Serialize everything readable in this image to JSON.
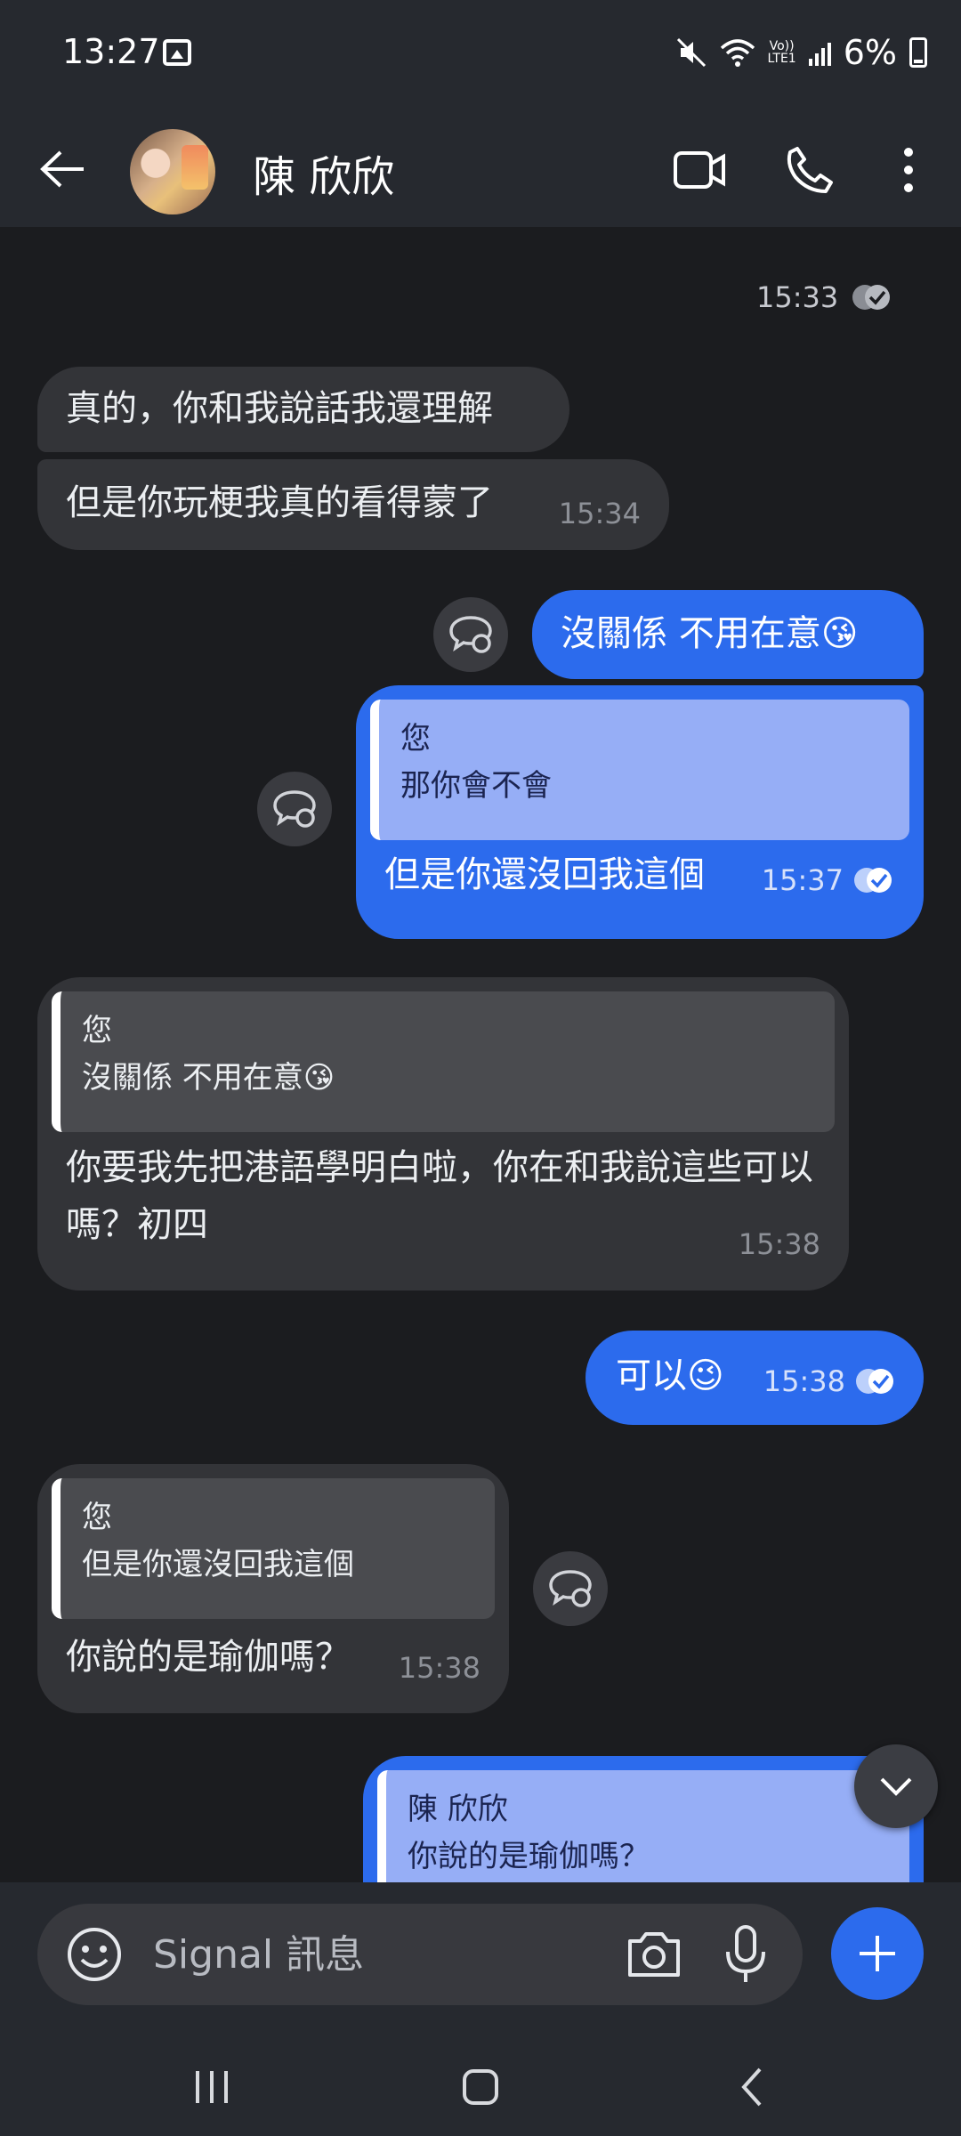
{
  "status_bar": {
    "time": "13:27",
    "volte": "Vo))\nLTE1",
    "battery": "6%"
  },
  "header": {
    "contact_name": "陳 欣欣"
  },
  "messages": [
    {
      "meta": "15:33"
    },
    {
      "text": "真的，你和我說話我還理解"
    },
    {
      "text": "但是你玩梗我真的看得蒙了",
      "time": "15:34"
    },
    {
      "text": "沒關係 不用在意😘"
    },
    {
      "quote_author": "您",
      "quote_text": "那你會不會",
      "text": "但是你還沒回我這個",
      "time": "15:37"
    },
    {
      "quote_author": "您",
      "quote_text": "沒關係 不用在意😘",
      "text": "你要我先把港語學明白啦，你在和我說這些可以嗎？初四",
      "time": "15:38"
    },
    {
      "text": "可以😉",
      "time": "15:38"
    },
    {
      "quote_author": "您",
      "quote_text": "但是你還沒回我這個",
      "text": "你說的是瑜伽嗎？",
      "time": "15:38"
    },
    {
      "quote_author": "陳 欣欣",
      "quote_text": "你說的是瑜伽嗎？"
    }
  ],
  "composer": {
    "placeholder": "Signal 訊息"
  },
  "colors": {
    "outgoing": "#2c6bed",
    "incoming": "#333438",
    "background": "#1b1c1f",
    "header": "#26292f"
  },
  "icons": [
    "back-arrow-icon",
    "video-call-icon",
    "phone-icon",
    "more-vert-icon",
    "reply-icon",
    "read-check-icon",
    "chevron-down-icon",
    "emoji-icon",
    "camera-icon",
    "mic-icon",
    "plus-icon",
    "nav-recents-icon",
    "nav-home-icon",
    "nav-back-icon"
  ]
}
